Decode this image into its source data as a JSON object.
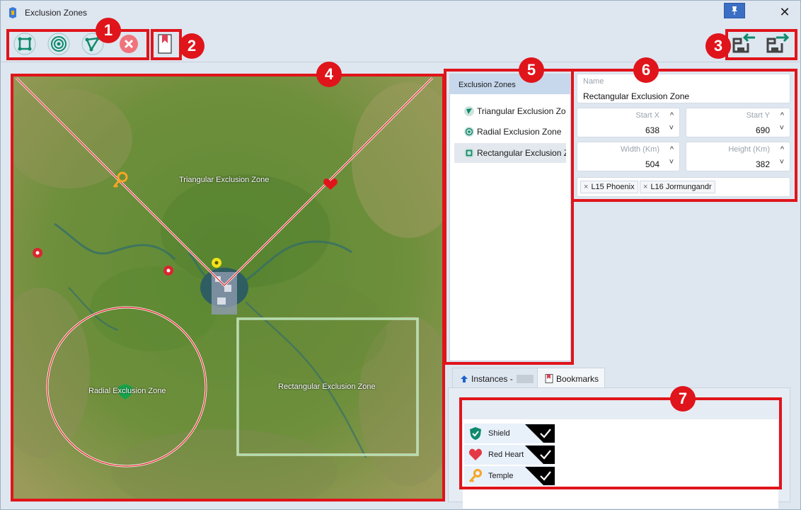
{
  "window": {
    "title": "Exclusion Zones",
    "pin_glyph": "📌",
    "close_glyph": "✕"
  },
  "toolbar": {
    "tools": [
      {
        "name": "add-rectangular-zone",
        "icon": "rectangle-zone-icon"
      },
      {
        "name": "add-radial-zone",
        "icon": "radial-zone-icon"
      },
      {
        "name": "add-triangular-zone",
        "icon": "triangle-zone-icon"
      },
      {
        "name": "delete-zone",
        "icon": "delete-icon"
      }
    ],
    "bookmark_icon": "bookmark-icon",
    "import_icon": "import-icon",
    "export_icon": "export-icon"
  },
  "callouts": [
    "1",
    "2",
    "3",
    "4",
    "5",
    "6",
    "7"
  ],
  "map": {
    "zones": [
      {
        "label": "Triangular Exclusion Zone",
        "type": "triangle"
      },
      {
        "label": "Radial Exclusion Zone",
        "type": "circle"
      },
      {
        "label": "Rectangular Exclusion Zone",
        "type": "rectangle"
      }
    ],
    "markers": [
      "key-marker",
      "heart-marker",
      "pin-red",
      "pin-red",
      "pin-yellow",
      "shield-marker"
    ]
  },
  "zone_list": {
    "header": "Exclusion Zones",
    "items": [
      {
        "label": "Triangular Exclusion Zone",
        "icon": "triangle-zone-icon",
        "selected": false
      },
      {
        "label": "Radial Exclusion Zone",
        "icon": "radial-zone-icon",
        "selected": false
      },
      {
        "label": "Rectangular Exclusion Zone",
        "icon": "rectangle-zone-icon",
        "selected": true
      }
    ]
  },
  "properties": {
    "name_label": "Name",
    "name_value": "Rectangular Exclusion Zone",
    "start_x_label": "Start X",
    "start_x_value": "638",
    "start_y_label": "Start Y",
    "start_y_value": "690",
    "width_label": "Width (Km)",
    "width_value": "504",
    "height_label": "Height (Km)",
    "height_value": "382",
    "tags": [
      "L15 Phoenix",
      "L16 Jormungandr"
    ],
    "tag_remove_glyph": "×",
    "spin_up_glyph": "^",
    "spin_down_glyph": "˅"
  },
  "tabs": {
    "instances_label": "Instances -",
    "bookmarks_label": "Bookmarks",
    "active": "Bookmarks"
  },
  "bookmarks": [
    {
      "label": "Shield",
      "icon": "shield-icon",
      "color": "#0f8a6d",
      "checked": true
    },
    {
      "label": "Red Heart",
      "icon": "heart-icon",
      "color": "#e53935",
      "checked": true
    },
    {
      "label": "Temple",
      "icon": "key-icon",
      "color": "#f5a623",
      "checked": true
    }
  ],
  "colors": {
    "callout_red": "#e0141b",
    "selection": "#c7d8ec",
    "zone_outline_red": "#e0141b",
    "zone_outline_green": "#9be08f"
  }
}
